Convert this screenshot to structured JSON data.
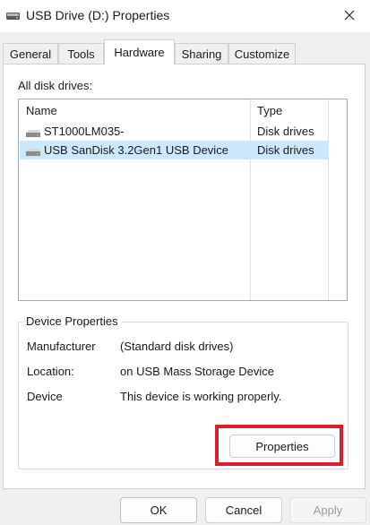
{
  "window": {
    "title": "USB Drive (D:) Properties",
    "icon": "usb-drive-icon"
  },
  "tabs": [
    {
      "label": "General",
      "active": false
    },
    {
      "label": "Tools",
      "active": false
    },
    {
      "label": "Hardware",
      "active": true
    },
    {
      "label": "Sharing",
      "active": false
    },
    {
      "label": "Customize",
      "active": false
    }
  ],
  "hardware": {
    "list_label": "All disk drives:",
    "columns": [
      "Name",
      "Type"
    ],
    "drives": [
      {
        "name": "ST1000LM035-",
        "type": "Disk drives",
        "selected": false,
        "icon": "disk-drive-icon"
      },
      {
        "name": "USB  SanDisk 3.2Gen1 USB Device",
        "type": "Disk drives",
        "selected": true,
        "icon": "disk-drive-icon"
      }
    ],
    "device_properties": {
      "title": "Device Properties",
      "rows": [
        {
          "label": "Manufacturer",
          "value": "(Standard disk drives)"
        },
        {
          "label": "Location:",
          "value": "on USB Mass Storage Device"
        },
        {
          "label": "Device",
          "value": "This device is working properly."
        }
      ],
      "properties_button": "Properties"
    }
  },
  "footer": {
    "ok": "OK",
    "cancel": "Cancel",
    "apply": "Apply"
  },
  "colors": {
    "selection": "#cce8ff",
    "highlight": "#d9202c"
  }
}
